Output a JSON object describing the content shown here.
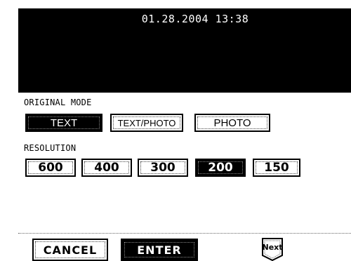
{
  "header": {
    "datetime": "01.28.2004 13:38"
  },
  "original_mode": {
    "label": "ORIGINAL MODE",
    "options": [
      "TEXT",
      "TEXT/PHOTO",
      "PHOTO"
    ],
    "selected": "TEXT"
  },
  "resolution": {
    "label": "RESOLUTION",
    "options": [
      "600",
      "400",
      "300",
      "200",
      "150"
    ],
    "selected": "200"
  },
  "footer": {
    "cancel_label": "CANCEL",
    "enter_label": "ENTER",
    "next_label": "Next"
  }
}
